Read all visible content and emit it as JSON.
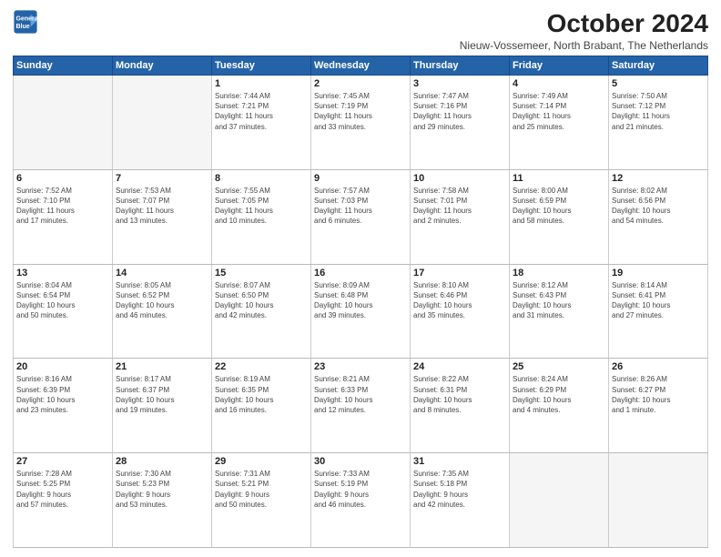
{
  "header": {
    "logo_line1": "General",
    "logo_line2": "Blue",
    "title": "October 2024",
    "location": "Nieuw-Vossemeer, North Brabant, The Netherlands"
  },
  "weekdays": [
    "Sunday",
    "Monday",
    "Tuesday",
    "Wednesday",
    "Thursday",
    "Friday",
    "Saturday"
  ],
  "weeks": [
    [
      {
        "day": "",
        "info": ""
      },
      {
        "day": "",
        "info": ""
      },
      {
        "day": "1",
        "info": "Sunrise: 7:44 AM\nSunset: 7:21 PM\nDaylight: 11 hours\nand 37 minutes."
      },
      {
        "day": "2",
        "info": "Sunrise: 7:45 AM\nSunset: 7:19 PM\nDaylight: 11 hours\nand 33 minutes."
      },
      {
        "day": "3",
        "info": "Sunrise: 7:47 AM\nSunset: 7:16 PM\nDaylight: 11 hours\nand 29 minutes."
      },
      {
        "day": "4",
        "info": "Sunrise: 7:49 AM\nSunset: 7:14 PM\nDaylight: 11 hours\nand 25 minutes."
      },
      {
        "day": "5",
        "info": "Sunrise: 7:50 AM\nSunset: 7:12 PM\nDaylight: 11 hours\nand 21 minutes."
      }
    ],
    [
      {
        "day": "6",
        "info": "Sunrise: 7:52 AM\nSunset: 7:10 PM\nDaylight: 11 hours\nand 17 minutes."
      },
      {
        "day": "7",
        "info": "Sunrise: 7:53 AM\nSunset: 7:07 PM\nDaylight: 11 hours\nand 13 minutes."
      },
      {
        "day": "8",
        "info": "Sunrise: 7:55 AM\nSunset: 7:05 PM\nDaylight: 11 hours\nand 10 minutes."
      },
      {
        "day": "9",
        "info": "Sunrise: 7:57 AM\nSunset: 7:03 PM\nDaylight: 11 hours\nand 6 minutes."
      },
      {
        "day": "10",
        "info": "Sunrise: 7:58 AM\nSunset: 7:01 PM\nDaylight: 11 hours\nand 2 minutes."
      },
      {
        "day": "11",
        "info": "Sunrise: 8:00 AM\nSunset: 6:59 PM\nDaylight: 10 hours\nand 58 minutes."
      },
      {
        "day": "12",
        "info": "Sunrise: 8:02 AM\nSunset: 6:56 PM\nDaylight: 10 hours\nand 54 minutes."
      }
    ],
    [
      {
        "day": "13",
        "info": "Sunrise: 8:04 AM\nSunset: 6:54 PM\nDaylight: 10 hours\nand 50 minutes."
      },
      {
        "day": "14",
        "info": "Sunrise: 8:05 AM\nSunset: 6:52 PM\nDaylight: 10 hours\nand 46 minutes."
      },
      {
        "day": "15",
        "info": "Sunrise: 8:07 AM\nSunset: 6:50 PM\nDaylight: 10 hours\nand 42 minutes."
      },
      {
        "day": "16",
        "info": "Sunrise: 8:09 AM\nSunset: 6:48 PM\nDaylight: 10 hours\nand 39 minutes."
      },
      {
        "day": "17",
        "info": "Sunrise: 8:10 AM\nSunset: 6:46 PM\nDaylight: 10 hours\nand 35 minutes."
      },
      {
        "day": "18",
        "info": "Sunrise: 8:12 AM\nSunset: 6:43 PM\nDaylight: 10 hours\nand 31 minutes."
      },
      {
        "day": "19",
        "info": "Sunrise: 8:14 AM\nSunset: 6:41 PM\nDaylight: 10 hours\nand 27 minutes."
      }
    ],
    [
      {
        "day": "20",
        "info": "Sunrise: 8:16 AM\nSunset: 6:39 PM\nDaylight: 10 hours\nand 23 minutes."
      },
      {
        "day": "21",
        "info": "Sunrise: 8:17 AM\nSunset: 6:37 PM\nDaylight: 10 hours\nand 19 minutes."
      },
      {
        "day": "22",
        "info": "Sunrise: 8:19 AM\nSunset: 6:35 PM\nDaylight: 10 hours\nand 16 minutes."
      },
      {
        "day": "23",
        "info": "Sunrise: 8:21 AM\nSunset: 6:33 PM\nDaylight: 10 hours\nand 12 minutes."
      },
      {
        "day": "24",
        "info": "Sunrise: 8:22 AM\nSunset: 6:31 PM\nDaylight: 10 hours\nand 8 minutes."
      },
      {
        "day": "25",
        "info": "Sunrise: 8:24 AM\nSunset: 6:29 PM\nDaylight: 10 hours\nand 4 minutes."
      },
      {
        "day": "26",
        "info": "Sunrise: 8:26 AM\nSunset: 6:27 PM\nDaylight: 10 hours\nand 1 minute."
      }
    ],
    [
      {
        "day": "27",
        "info": "Sunrise: 7:28 AM\nSunset: 5:25 PM\nDaylight: 9 hours\nand 57 minutes."
      },
      {
        "day": "28",
        "info": "Sunrise: 7:30 AM\nSunset: 5:23 PM\nDaylight: 9 hours\nand 53 minutes."
      },
      {
        "day": "29",
        "info": "Sunrise: 7:31 AM\nSunset: 5:21 PM\nDaylight: 9 hours\nand 50 minutes."
      },
      {
        "day": "30",
        "info": "Sunrise: 7:33 AM\nSunset: 5:19 PM\nDaylight: 9 hours\nand 46 minutes."
      },
      {
        "day": "31",
        "info": "Sunrise: 7:35 AM\nSunset: 5:18 PM\nDaylight: 9 hours\nand 42 minutes."
      },
      {
        "day": "",
        "info": ""
      },
      {
        "day": "",
        "info": ""
      }
    ]
  ]
}
